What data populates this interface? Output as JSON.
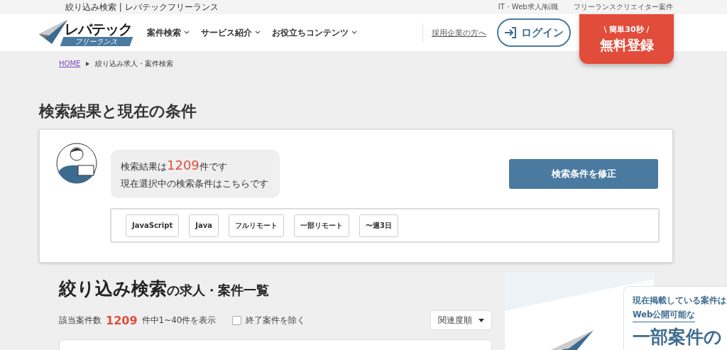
{
  "top_bar": {
    "site_title": "絞り込み検索 | レバテックフリーランス",
    "links": [
      "IT・Web求人/転職",
      "フリーランスクリエイター案件"
    ]
  },
  "header": {
    "logo": {
      "main": "レバテック",
      "sub": "フリーランス"
    },
    "nav": [
      {
        "label": "案件検索"
      },
      {
        "label": "サービス紹介"
      },
      {
        "label": "お役立ちコンテンツ"
      }
    ],
    "company_link": "採用企業の方へ",
    "login": "ログイン",
    "register": {
      "note": "\\ 簡単30秒 /",
      "label": "無料登録"
    }
  },
  "breadcrumb": [
    {
      "label": "HOME",
      "link": true
    },
    {
      "label": "絞り込み求人・案件検索",
      "link": false
    }
  ],
  "page_title": "検索結果と現在の条件",
  "summary": {
    "line1_prefix": "検索結果は",
    "count": "1209",
    "line1_suffix": "件です",
    "line2": "現在選択中の検索条件はこちらです",
    "edit_button": "検索条件を修正",
    "conditions": [
      "JavaScript",
      "Java",
      "フルリモート",
      "一部リモート",
      "〜週3日"
    ]
  },
  "listing": {
    "title_keyword": "絞り込み検索",
    "title_suffix": "の求人・案件一覧",
    "count_label": "該当案件数",
    "count": "1209",
    "count_suffix": "件中1~40件を表示",
    "exclude_closed": {
      "label": "終了案件を除く",
      "checked": false
    },
    "sort": "関連度順"
  },
  "promo": {
    "line1": "現在掲載している案件は",
    "line2": "Web公開可能な",
    "line3": "一部案件の"
  }
}
